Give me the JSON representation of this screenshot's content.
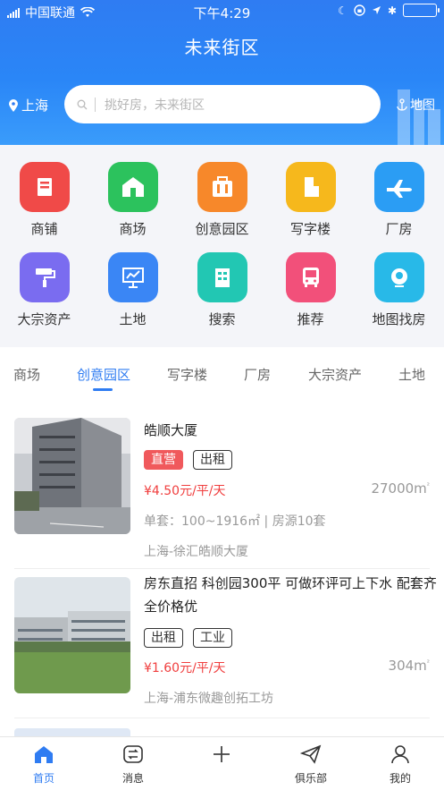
{
  "status": {
    "carrier": "中国联通",
    "time": "下午4:29"
  },
  "header": {
    "title": "未来街区",
    "city": "上海",
    "search_placeholder": "挑好房，未来街区",
    "map_label": "地图"
  },
  "grid": [
    {
      "label": "商铺",
      "icon": "shop-icon",
      "color": "#f04a48"
    },
    {
      "label": "商场",
      "icon": "mall-icon",
      "color": "#2cc25d"
    },
    {
      "label": "创意园区",
      "icon": "creative-park-icon",
      "color": "#f7882a"
    },
    {
      "label": "写字楼",
      "icon": "office-building-icon",
      "color": "#f6b81c"
    },
    {
      "label": "厂房",
      "icon": "airplane-icon",
      "color": "#2b9df4"
    },
    {
      "label": "大宗资产",
      "icon": "paint-roller-icon",
      "color": "#7a6cf0"
    },
    {
      "label": "土地",
      "icon": "chart-board-icon",
      "color": "#3a86f5"
    },
    {
      "label": "搜索",
      "icon": "search-building-icon",
      "color": "#22c7b3"
    },
    {
      "label": "推荐",
      "icon": "bus-icon",
      "color": "#f2507a"
    },
    {
      "label": "地图找房",
      "icon": "map-pin-icon",
      "color": "#28b9e8"
    }
  ],
  "tabs": [
    "商场",
    "创意园区",
    "写字楼",
    "厂房",
    "大宗资产",
    "土地"
  ],
  "active_tab": "创意园区",
  "listings": [
    {
      "title": "皓顺大厦",
      "tags": [
        "直营",
        "出租"
      ],
      "price": "¥4.50元/平/天",
      "area": "27000m",
      "area_unit": "²",
      "meta": "单套：100~1916㎡ | 房源10套",
      "location": "上海-徐汇皓顺大厦"
    },
    {
      "title_line1": "房东直招 科创园300平 可做环评可上下水 配套齐",
      "title_line2": "全价格优",
      "tags": [
        "出租",
        "工业"
      ],
      "price": "¥1.60元/平/天",
      "area": "304m",
      "area_unit": "²",
      "location": "上海-浦东微趣创拓工坊"
    }
  ],
  "bottom_nav": [
    {
      "label": "首页",
      "icon": "home-icon"
    },
    {
      "label": "消息",
      "icon": "message-icon"
    },
    {
      "label": "",
      "icon": "plus-icon"
    },
    {
      "label": "俱乐部",
      "icon": "paper-plane-icon"
    },
    {
      "label": "我的",
      "icon": "user-icon"
    }
  ]
}
